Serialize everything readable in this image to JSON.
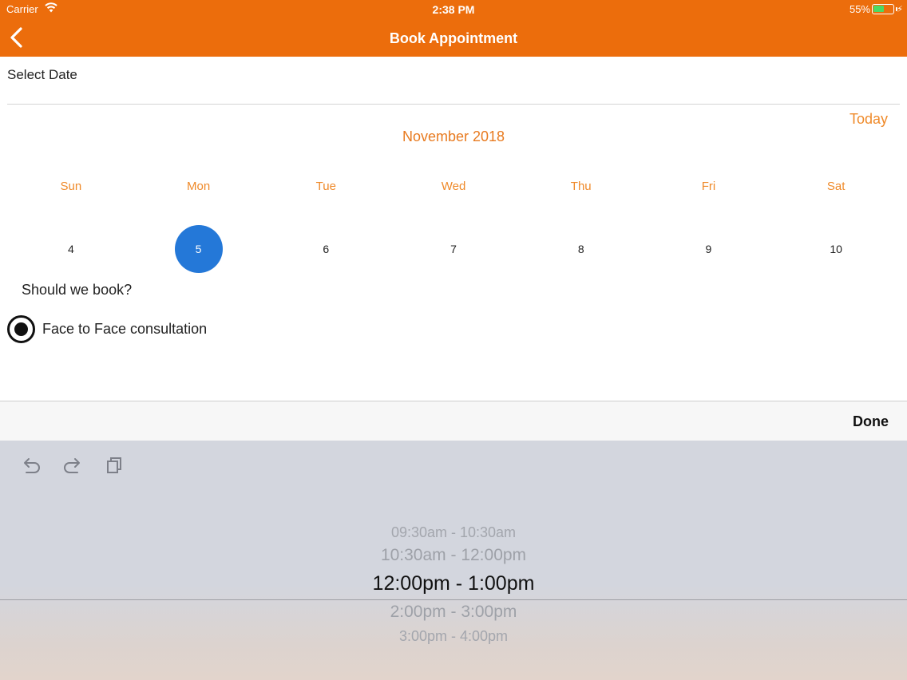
{
  "status_bar": {
    "carrier": "Carrier",
    "time": "2:38 PM",
    "battery_percent": "55%",
    "battery_level": 0.55,
    "battery_color": "#4cd964"
  },
  "nav": {
    "back_icon": "chevron-left-icon",
    "title": "Book Appointment",
    "background_color": "#ec6d0c"
  },
  "form": {
    "select_date_label": "Select Date",
    "today_label": "Today",
    "month_title": "November 2018",
    "weekdays": [
      "Sun",
      "Mon",
      "Tue",
      "Wed",
      "Thu",
      "Fri",
      "Sat"
    ],
    "days": [
      "4",
      "5",
      "6",
      "7",
      "8",
      "9",
      "10"
    ],
    "selected_day": "5",
    "accent_color": "#ef8a2a",
    "selected_color": "#2478d8",
    "question": "Should we book?",
    "option_label": "Face to Face consultation",
    "option_selected": true
  },
  "toolbar": {
    "done_label": "Done",
    "icons": [
      "undo-icon",
      "redo-icon",
      "paste-icon"
    ]
  },
  "picker": {
    "options": [
      "09:30am - 10:30am",
      "10:30am - 12:00pm",
      "12:00pm - 1:00pm",
      "2:00pm - 3:00pm",
      "3:00pm - 4:00pm"
    ],
    "selected": "12:00pm - 1:00pm"
  }
}
